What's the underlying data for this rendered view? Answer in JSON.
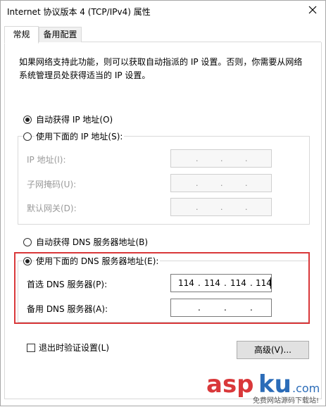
{
  "window": {
    "title": "Internet 协议版本 4 (TCP/IPv4) 属性"
  },
  "tabs": [
    {
      "label": "常规"
    },
    {
      "label": "备用配置"
    }
  ],
  "description": "如果网络支持此功能，则可以获取自动指派的 IP 设置。否则，你需要从网络系统管理员处获得适当的 IP 设置。",
  "ip_section": {
    "auto_label": "自动获得 IP 地址(O)",
    "manual_label": "使用下面的 IP 地址(S):",
    "auto_selected": true,
    "fields": [
      {
        "label": "IP 地址(I):",
        "value": ". . ."
      },
      {
        "label": "子网掩码(U):",
        "value": ". . ."
      },
      {
        "label": "默认网关(D):",
        "value": ". . ."
      }
    ]
  },
  "dns_section": {
    "auto_label": "自动获得 DNS 服务器地址(B)",
    "manual_label": "使用下面的 DNS 服务器地址(E):",
    "manual_selected": true,
    "preferred": {
      "label": "首选 DNS 服务器(P):",
      "octets": [
        "114",
        "114",
        "114",
        "114"
      ]
    },
    "alternate": {
      "label": "备用 DNS 服务器(A):",
      "octets": [
        "",
        "",
        "",
        ""
      ]
    }
  },
  "validate_on_exit": {
    "label": "退出时验证设置(L)",
    "checked": false
  },
  "advanced_button": "高级(V)...",
  "watermark": {
    "main": "aspku",
    "sub": ".com",
    "tagline": "免费网站源码下载站!"
  },
  "colors": {
    "highlight": "#d9383a",
    "watermark_red": "#d9383a",
    "watermark_blue": "#2b6cb8"
  },
  "icons": [
    "close-icon",
    "radio-icon",
    "checkbox-icon"
  ]
}
